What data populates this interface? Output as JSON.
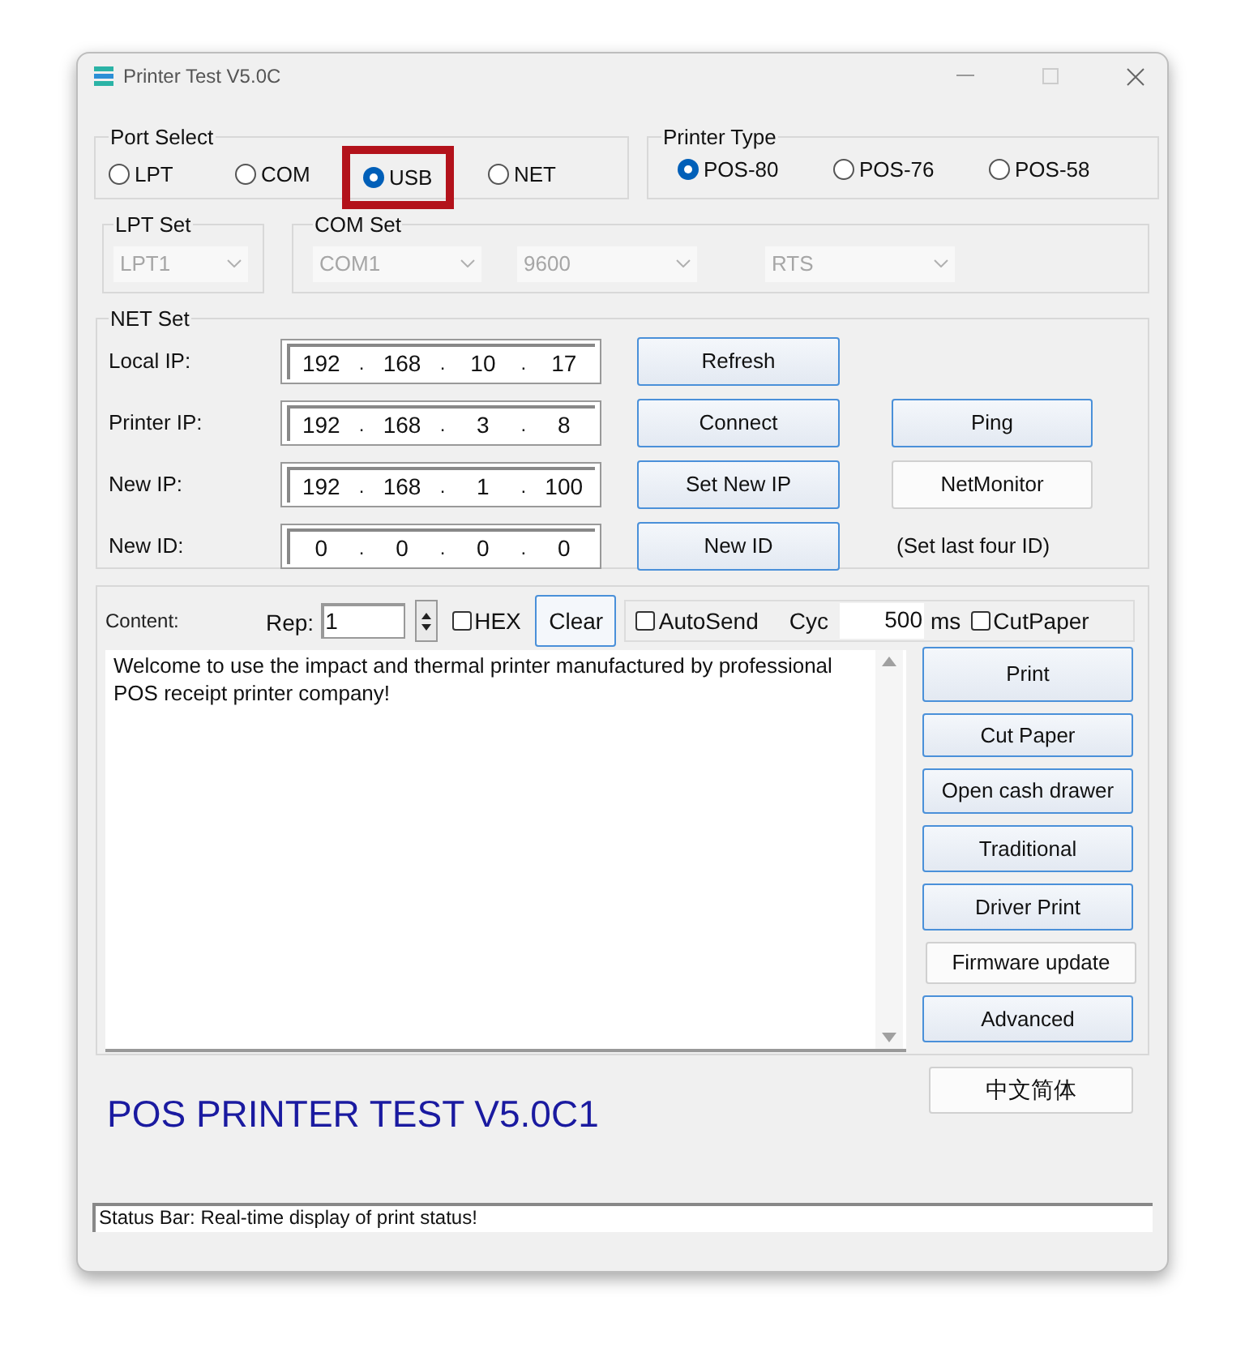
{
  "window": {
    "title": "Printer Test V5.0C"
  },
  "port_select": {
    "label": "Port Select",
    "options": [
      {
        "label": "LPT",
        "selected": false,
        "highlighted": false
      },
      {
        "label": "COM",
        "selected": false,
        "highlighted": false
      },
      {
        "label": "USB",
        "selected": true,
        "highlighted": true
      },
      {
        "label": "NET",
        "selected": false,
        "highlighted": false
      }
    ]
  },
  "printer_type": {
    "label": "Printer Type",
    "options": [
      {
        "label": "POS-80",
        "selected": true
      },
      {
        "label": "POS-76",
        "selected": false
      },
      {
        "label": "POS-58",
        "selected": false
      }
    ]
  },
  "lpt_set": {
    "label": "LPT Set",
    "combo": {
      "value": "LPT1",
      "disabled": true
    }
  },
  "com_set": {
    "label": "COM Set",
    "combos": [
      {
        "value": "COM1",
        "disabled": true
      },
      {
        "value": "9600",
        "disabled": true
      },
      {
        "value": "RTS",
        "disabled": true
      }
    ]
  },
  "net_set": {
    "label": "NET Set",
    "separator": ".",
    "rows": [
      {
        "label": "Local IP:",
        "octets": [
          "192",
          "168",
          "10",
          "17"
        ],
        "button": {
          "label": "Refresh",
          "kind": "accent"
        }
      },
      {
        "label": "Printer IP:",
        "octets": [
          "192",
          "168",
          "3",
          "8"
        ],
        "button": {
          "label": "Connect",
          "kind": "accent"
        },
        "extra": {
          "label": "Ping",
          "kind": "accent"
        }
      },
      {
        "label": "New IP:",
        "octets": [
          "192",
          "168",
          "1",
          "100"
        ],
        "button": {
          "label": "Set New IP",
          "kind": "accent"
        },
        "extra": {
          "label": "NetMonitor",
          "kind": "plain"
        }
      },
      {
        "label": "New ID:",
        "octets": [
          "0",
          "0",
          "0",
          "0"
        ],
        "button": {
          "label": "New ID",
          "kind": "accent"
        },
        "extra": {
          "label": "(Set last four ID)",
          "kind": "note"
        }
      }
    ]
  },
  "content": {
    "label": "Content:",
    "rep_label": "Rep:",
    "rep_value": "1",
    "hex": {
      "label": "HEX",
      "checked": false
    },
    "clear": "Clear",
    "autosend": {
      "label": "AutoSend",
      "checked": false
    },
    "cyc_label": "Cyc",
    "cyc_value": "500",
    "ms_label": "ms",
    "cutpaper": {
      "label": "CutPaper",
      "checked": false
    },
    "text": "Welcome to use the impact and thermal printer manufactured by professional POS receipt printer company!",
    "buttons": [
      {
        "label": "Print",
        "kind": "accent"
      },
      {
        "label": "Cut Paper",
        "kind": "accent"
      },
      {
        "label": "Open cash drawer",
        "kind": "accent"
      },
      {
        "label": "Traditional",
        "kind": "accent"
      },
      {
        "label": "Driver Print",
        "kind": "accent"
      },
      {
        "label": "Firmware update",
        "kind": "plain"
      },
      {
        "label": "Advanced",
        "kind": "accent"
      }
    ]
  },
  "language_button": {
    "label": "中文简体",
    "kind": "plain"
  },
  "banner": "POS PRINTER TEST V5.0C1",
  "status_bar": "Status Bar: Real-time display of print status!"
}
